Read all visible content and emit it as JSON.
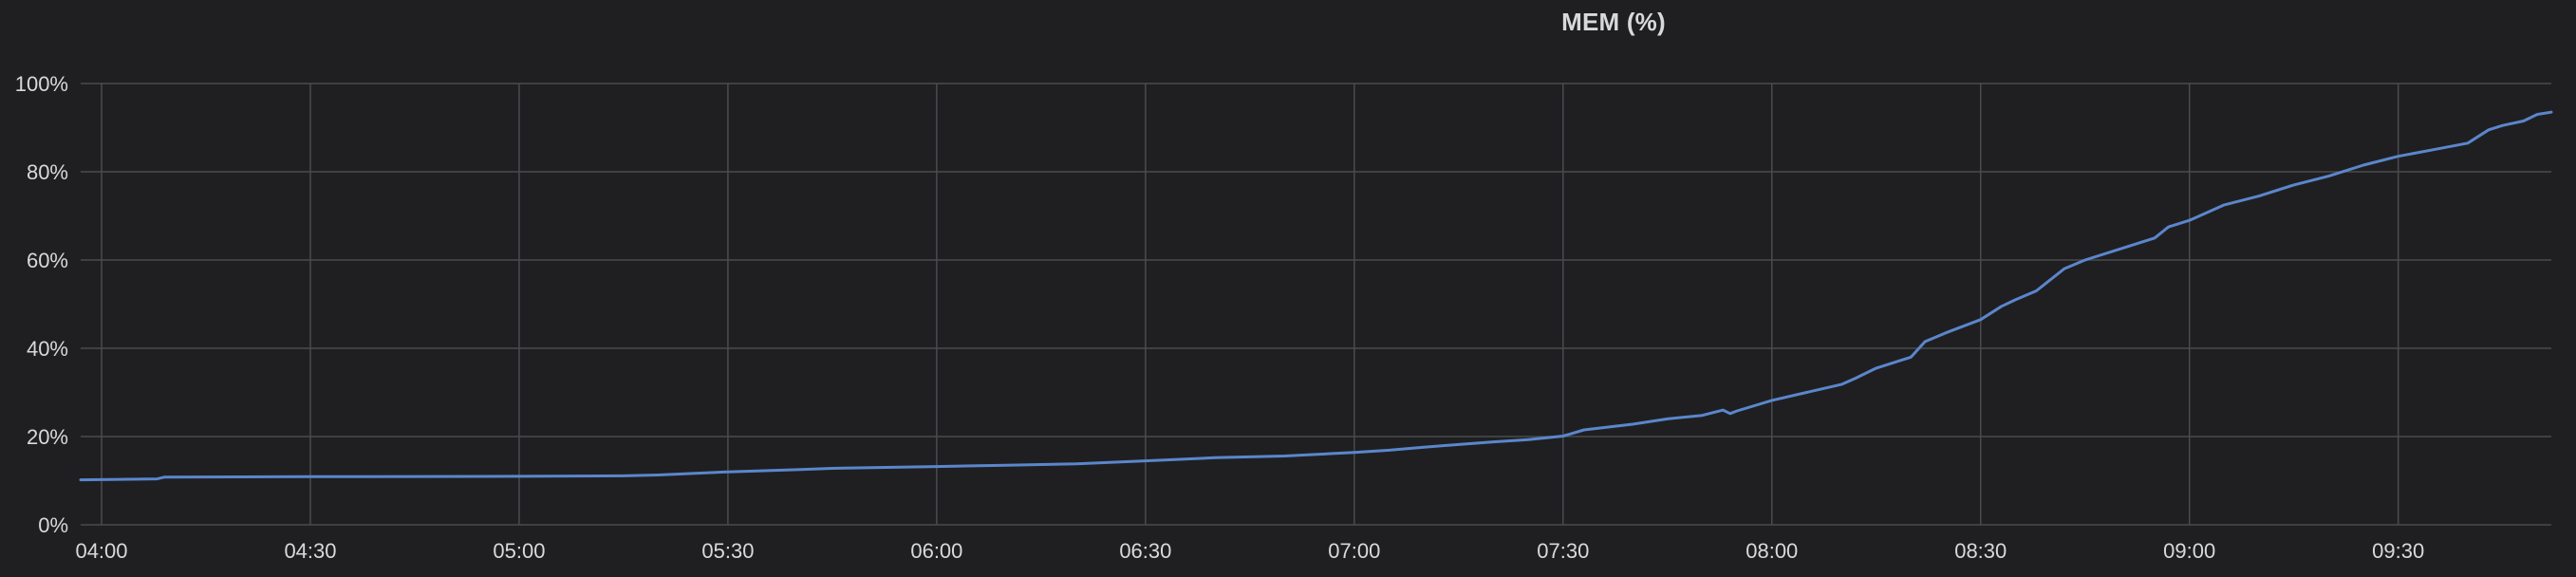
{
  "panel": {
    "title": "MEM (%)"
  },
  "colors": {
    "background": "#1f1f21",
    "grid": "#4a4b4e",
    "text": "#d8d9da",
    "series": "#5b86cc"
  },
  "chart_data": {
    "type": "line",
    "title": "MEM (%)",
    "xlabel": "",
    "ylabel": "",
    "grid": true,
    "legend": "none",
    "xlim": [
      "03:57",
      "09:52"
    ],
    "ylim": [
      0,
      100
    ],
    "x_ticks": [
      "04:00",
      "04:30",
      "05:00",
      "05:30",
      "06:00",
      "06:30",
      "07:00",
      "07:30",
      "08:00",
      "08:30",
      "09:00",
      "09:30"
    ],
    "y_ticks": [
      0,
      20,
      40,
      60,
      80,
      100
    ],
    "y_tick_labels": [
      "0%",
      "20%",
      "40%",
      "60%",
      "80%",
      "100%"
    ],
    "series": [
      {
        "color": "#5b86cc",
        "x": [
          "03:57",
          "04:08",
          "04:09",
          "04:30",
          "05:00",
          "05:15",
          "05:20",
          "05:30",
          "05:40",
          "05:45",
          "06:00",
          "06:10",
          "06:20",
          "06:30",
          "06:40",
          "06:50",
          "07:00",
          "07:05",
          "07:10",
          "07:15",
          "07:20",
          "07:25",
          "07:30",
          "07:33",
          "07:40",
          "07:45",
          "07:50",
          "07:53",
          "07:54",
          "07:55",
          "08:00",
          "08:05",
          "08:10",
          "08:12",
          "08:15",
          "08:20",
          "08:22",
          "08:25",
          "08:30",
          "08:33",
          "08:35",
          "08:38",
          "08:42",
          "08:45",
          "08:50",
          "08:55",
          "08:57",
          "09:00",
          "09:05",
          "09:10",
          "09:15",
          "09:20",
          "09:25",
          "09:30",
          "09:35",
          "09:40",
          "09:43",
          "09:45",
          "09:48",
          "09:50",
          "09:52"
        ],
        "y": [
          10.2,
          10.4,
          10.8,
          10.9,
          11.0,
          11.1,
          11.3,
          12.0,
          12.5,
          12.8,
          13.2,
          13.5,
          13.8,
          14.5,
          15.2,
          15.6,
          16.4,
          16.9,
          17.6,
          18.2,
          18.8,
          19.3,
          20.1,
          21.5,
          22.8,
          24.0,
          24.8,
          26.0,
          25.2,
          25.8,
          28.2,
          30.0,
          31.8,
          33.2,
          35.5,
          38.0,
          41.5,
          43.5,
          46.5,
          49.5,
          51.0,
          53.0,
          58.0,
          60.0,
          62.5,
          65.0,
          67.5,
          69.0,
          72.5,
          74.5,
          77.0,
          79.0,
          81.5,
          83.5,
          85.0,
          86.5,
          89.5,
          90.5,
          91.5,
          93.0,
          93.5
        ]
      }
    ]
  }
}
